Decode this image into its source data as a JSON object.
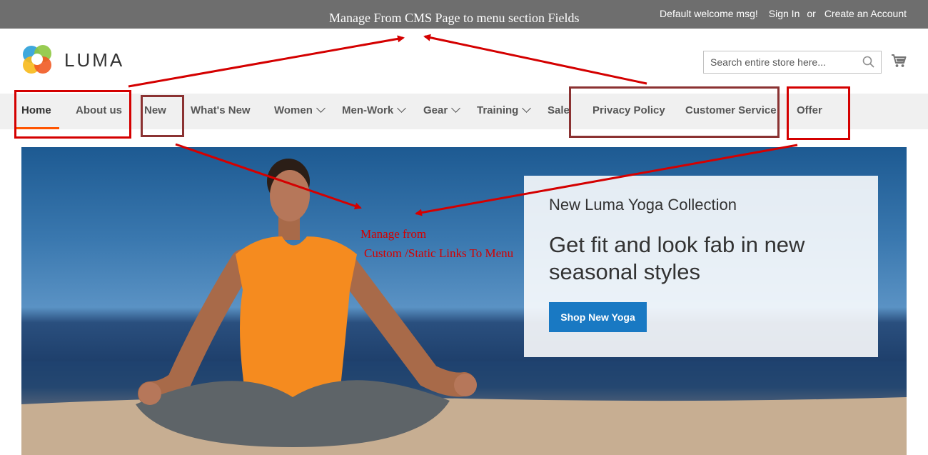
{
  "top_bar": {
    "annotation": "Manage From CMS Page to menu section Fields",
    "welcome": "Default welcome msg!",
    "sign_in": "Sign In",
    "or": "or",
    "create_account": "Create an Account"
  },
  "header": {
    "logo_text": "LUMA",
    "search_placeholder": "Search entire store here...",
    "search_icon": "search-icon",
    "cart_icon": "cart-icon"
  },
  "nav": {
    "items": [
      {
        "label": "Home",
        "active": true,
        "has_dropdown": false
      },
      {
        "label": "About us",
        "has_dropdown": false
      },
      {
        "label": "New",
        "has_dropdown": false
      },
      {
        "label": "What's New",
        "has_dropdown": false
      },
      {
        "label": "Women",
        "has_dropdown": true
      },
      {
        "label": "Men-Work",
        "has_dropdown": true
      },
      {
        "label": "Gear",
        "has_dropdown": true
      },
      {
        "label": "Training",
        "has_dropdown": true
      },
      {
        "label": "Sale",
        "has_dropdown": false
      },
      {
        "label": "Privacy Policy",
        "has_dropdown": false
      },
      {
        "label": "Customer Service",
        "has_dropdown": false
      },
      {
        "label": "Offer",
        "has_dropdown": false
      }
    ]
  },
  "hero": {
    "subtitle": "New Luma Yoga Collection",
    "title": "Get fit and look fab in new seasonal styles",
    "button": "Shop New Yoga"
  },
  "annotations": {
    "custom_links_line1": "Manage from",
    "custom_links_line2": "Custom /Static Links To Menu"
  },
  "colors": {
    "accent": "#ff5501",
    "button": "#1979c3",
    "annotation": "#d40000",
    "top_bar": "#6e6e6e",
    "nav_bg": "#f0f0f0"
  }
}
